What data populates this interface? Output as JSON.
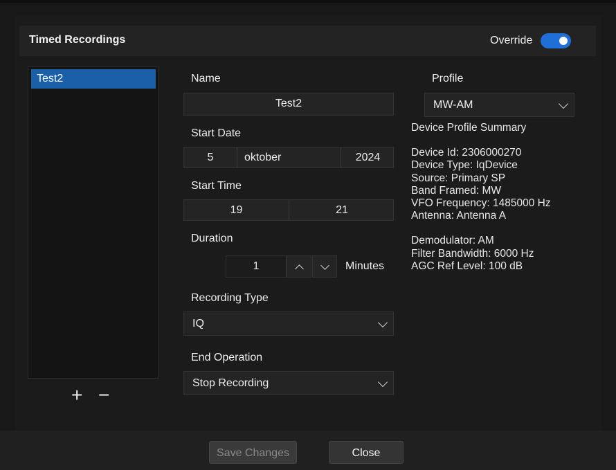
{
  "header": {
    "title": "Timed Recordings",
    "override_label": "Override",
    "override_on": true
  },
  "recordings": {
    "items": [
      "Test2"
    ],
    "selected": "Test2",
    "add_symbol": "+",
    "remove_symbol": "−"
  },
  "form": {
    "name_label": "Name",
    "name_value": "Test2",
    "start_date_label": "Start Date",
    "start_date": {
      "day": "5",
      "month": "oktober",
      "year": "2024"
    },
    "start_time_label": "Start Time",
    "start_time": {
      "hour": "19",
      "minute": "21"
    },
    "duration_label": "Duration",
    "duration_value": "1",
    "duration_unit": "Minutes",
    "recording_type_label": "Recording Type",
    "recording_type_value": "IQ",
    "end_operation_label": "End Operation",
    "end_operation_value": "Stop Recording"
  },
  "profile": {
    "label": "Profile",
    "value": "MW-AM",
    "summary_title": "Device Profile Summary",
    "lines1": [
      "Device Id: 2306000270",
      "Device Type: IqDevice",
      "Source: Primary SP",
      "Band Framed: MW",
      "VFO Frequency: 1485000 Hz",
      "Antenna: Antenna A"
    ],
    "lines2": [
      "Demodulator: AM",
      "Filter Bandwidth: 6000 Hz",
      "AGC Ref Level: 100 dB"
    ]
  },
  "footer": {
    "save_label": "Save Changes",
    "close_label": "Close"
  },
  "colors": {
    "accent": "#1f6fd6",
    "selected_row": "#1b5fa8",
    "background": "#1b1b1b"
  }
}
